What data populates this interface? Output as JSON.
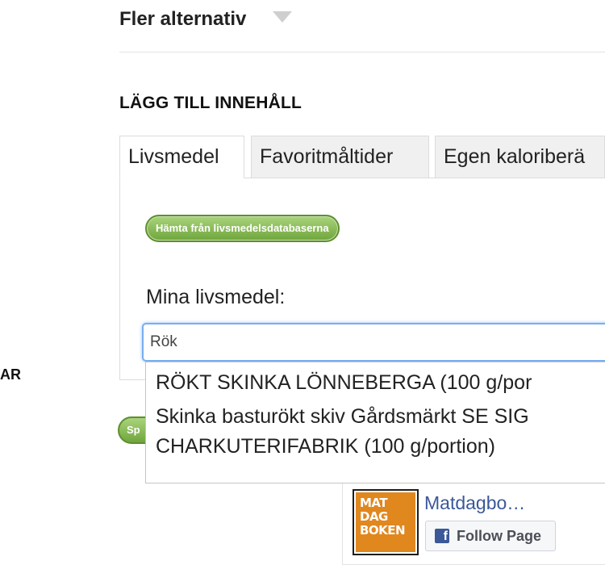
{
  "more_options": {
    "title": "Fler alternativ"
  },
  "add_content": {
    "title": "LÄGG TILL INNEHÅLL"
  },
  "left_fragment": "AR",
  "tabs": [
    {
      "label": "Livsmedel",
      "active": true
    },
    {
      "label": "Favoritmåltider",
      "active": false
    },
    {
      "label": "Egen kaloriberä",
      "active": false
    }
  ],
  "fetch_button": {
    "label": "Hämta från livsmedelsdatabaserna"
  },
  "my_foods": {
    "label": "Mina livsmedel:",
    "search_value": "Rök"
  },
  "save_button": {
    "label": "Sp"
  },
  "suggestions": [
    {
      "line1": "RÖKT SKINKA LÖNNEBERGA (100 g/por",
      "line2": ""
    },
    {
      "line1": "Skinka basturökt skiv Gårdsmärkt SE SIG",
      "line2": "CHARKUTERIFABRIK (100 g/portion)"
    }
  ],
  "facebook": {
    "page_name": "Matdagbo…",
    "follow_label": "Follow Page",
    "logo_lines": [
      "MAT",
      "DAG",
      "BOKEN"
    ],
    "logo_color": "#e0871e",
    "link_color": "#3b5998"
  },
  "colors": {
    "button_green": "#6fa53c",
    "focus_blue": "#79aef0"
  }
}
